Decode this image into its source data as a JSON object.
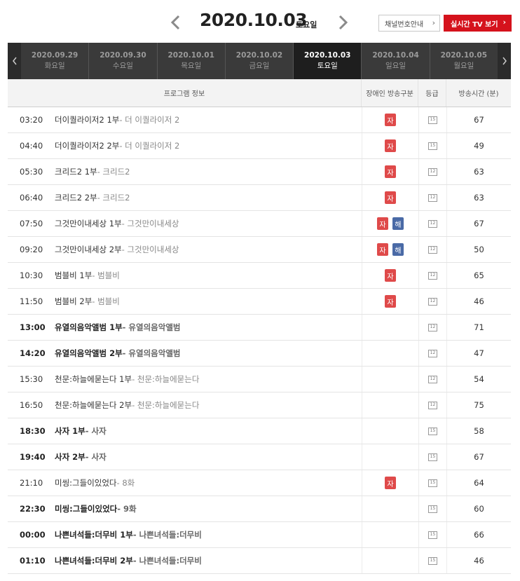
{
  "header": {
    "date": "2020.10.03",
    "weekday": "토요일",
    "channel_guide_label": "채널번호안내",
    "live_tv_label": "실시간 TV 보기"
  },
  "tabs": [
    {
      "date": "2020.09.29",
      "weekday": "화요일",
      "active": false
    },
    {
      "date": "2020.09.30",
      "weekday": "수요일",
      "active": false
    },
    {
      "date": "2020.10.01",
      "weekday": "목요일",
      "active": false
    },
    {
      "date": "2020.10.02",
      "weekday": "금요일",
      "active": false
    },
    {
      "date": "2020.10.03",
      "weekday": "토요일",
      "active": true
    },
    {
      "date": "2020.10.04",
      "weekday": "일요일",
      "active": false
    },
    {
      "date": "2020.10.05",
      "weekday": "월요일",
      "active": false
    }
  ],
  "table": {
    "headers": {
      "program": "프로그램 정보",
      "disability": "장애인 방송구분",
      "grade": "등급",
      "duration": "방송시간 (분)"
    },
    "rows": [
      {
        "time": "03:20",
        "title": "더이퀄라이저2 1부",
        "sub": " - 더 이퀄라이저 2",
        "badges": [
          "자"
        ],
        "grade": "15",
        "duration": "67",
        "bold": false
      },
      {
        "time": "04:40",
        "title": "더이퀄라이저2 2부",
        "sub": " - 더 이퀄라이저 2",
        "badges": [
          "자"
        ],
        "grade": "15",
        "duration": "49",
        "bold": false
      },
      {
        "time": "05:30",
        "title": "크리드2 1부",
        "sub": " - 크리드2",
        "badges": [
          "자"
        ],
        "grade": "12",
        "duration": "63",
        "bold": false
      },
      {
        "time": "06:40",
        "title": "크리드2 2부",
        "sub": " - 크리드2",
        "badges": [
          "자"
        ],
        "grade": "12",
        "duration": "63",
        "bold": false
      },
      {
        "time": "07:50",
        "title": "그것만이내세상 1부",
        "sub": " - 그것만이내세상",
        "badges": [
          "자",
          "해"
        ],
        "grade": "12",
        "duration": "67",
        "bold": false
      },
      {
        "time": "09:20",
        "title": "그것만이내세상 2부",
        "sub": " - 그것만이내세상",
        "badges": [
          "자",
          "해"
        ],
        "grade": "12",
        "duration": "50",
        "bold": false
      },
      {
        "time": "10:30",
        "title": "범블비 1부",
        "sub": " - 범블비",
        "badges": [
          "자"
        ],
        "grade": "12",
        "duration": "65",
        "bold": false
      },
      {
        "time": "11:50",
        "title": "범블비 2부",
        "sub": " - 범블비",
        "badges": [
          "자"
        ],
        "grade": "12",
        "duration": "46",
        "bold": false
      },
      {
        "time": "13:00",
        "title": "유열의음악앨범 1부",
        "sub": " - 유열의음악앨범",
        "badges": [],
        "grade": "12",
        "duration": "71",
        "bold": true
      },
      {
        "time": "14:20",
        "title": "유열의음악앨범 2부",
        "sub": " - 유열의음악앨범",
        "badges": [],
        "grade": "12",
        "duration": "47",
        "bold": true
      },
      {
        "time": "15:30",
        "title": "천문:하늘에묻는다 1부",
        "sub": " - 천문:하늘에묻는다",
        "badges": [],
        "grade": "12",
        "duration": "54",
        "bold": false
      },
      {
        "time": "16:50",
        "title": "천문:하늘에묻는다 2부",
        "sub": " - 천문:하늘에묻는다",
        "badges": [],
        "grade": "12",
        "duration": "75",
        "bold": false
      },
      {
        "time": "18:30",
        "title": "사자 1부",
        "sub": " - 사자",
        "badges": [],
        "grade": "15",
        "duration": "58",
        "bold": true
      },
      {
        "time": "19:40",
        "title": "사자 2부",
        "sub": " - 사자",
        "badges": [],
        "grade": "15",
        "duration": "67",
        "bold": true
      },
      {
        "time": "21:10",
        "title": "미씽:그들이있었다",
        "sub": " - 8화",
        "badges": [
          "자"
        ],
        "grade": "15",
        "duration": "64",
        "bold": false
      },
      {
        "time": "22:30",
        "title": "미씽:그들이있었다",
        "sub": " - 9화",
        "badges": [],
        "grade": "15",
        "duration": "60",
        "bold": true
      },
      {
        "time": "00:00",
        "title": "나쁜녀석들:더무비 1부",
        "sub": " - 나쁜녀석들:더무비",
        "badges": [],
        "grade": "15",
        "duration": "66",
        "bold": true
      },
      {
        "time": "01:10",
        "title": "나쁜녀석들:더무비 2부",
        "sub": " - 나쁜녀석들:더무비",
        "badges": [],
        "grade": "15",
        "duration": "46",
        "bold": true
      }
    ]
  }
}
